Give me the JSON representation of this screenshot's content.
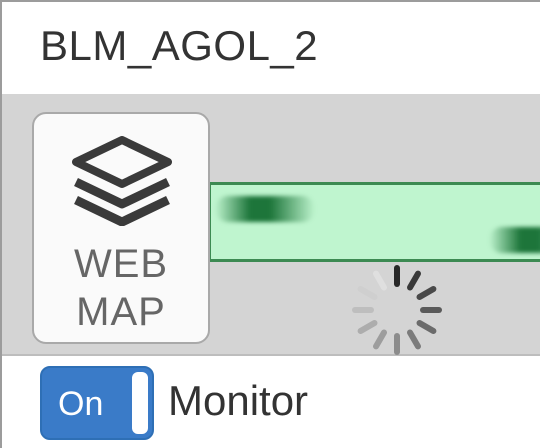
{
  "item": {
    "title": "BLM_AGOL_2",
    "tile": {
      "icon": "layers-icon",
      "label_line1": "WEB",
      "label_line2": "MAP"
    },
    "status": {
      "indicator": "indeterminate-progress-bar",
      "spinner": "loading-spinner-icon"
    }
  },
  "monitor": {
    "toggle_label": "On",
    "label": "Monitor",
    "state": "on"
  },
  "colors": {
    "toggle_on": "#3a7bc8",
    "progress_fill": "#bff5cf",
    "progress_border": "#3c8a52",
    "content_bg": "#d4d4d4"
  }
}
